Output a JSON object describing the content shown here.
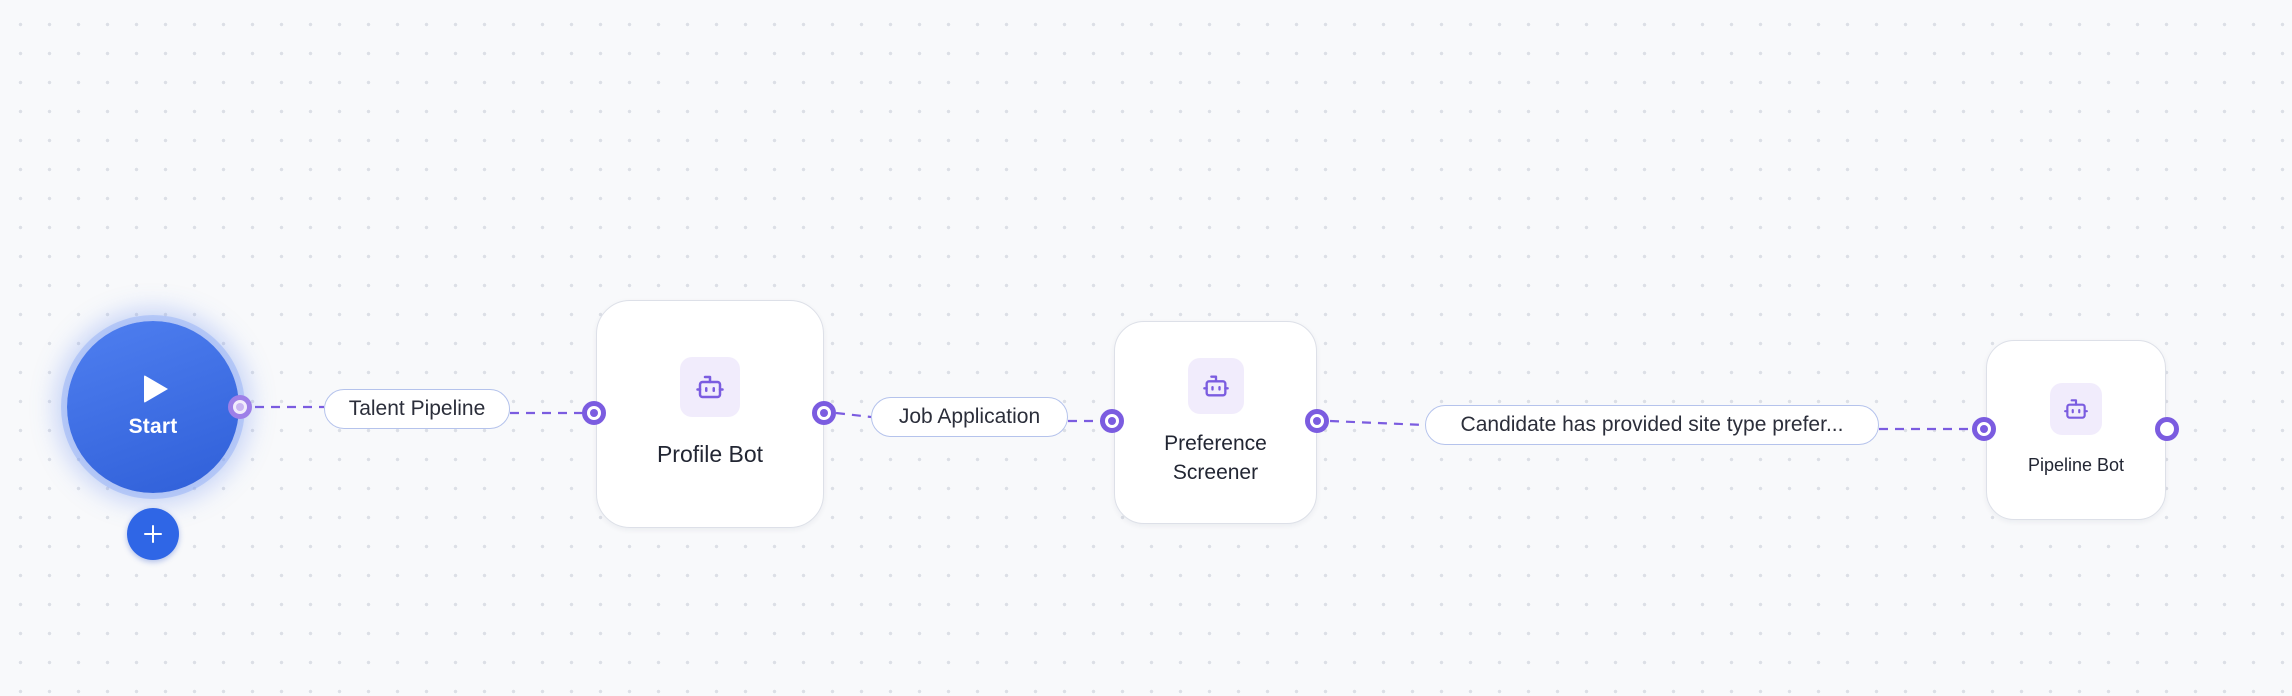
{
  "start_node": {
    "label": "Start",
    "icon": "play-icon"
  },
  "add_button": {
    "icon": "plus-icon"
  },
  "nodes": [
    {
      "id": "profile",
      "title": "Profile Bot",
      "icon": "bot-icon"
    },
    {
      "id": "pref",
      "title": "Preference Screener",
      "icon": "bot-icon"
    },
    {
      "id": "pipeline",
      "title": "Pipeline Bot",
      "icon": "bot-icon"
    }
  ],
  "edges": [
    {
      "from": "start",
      "to": "profile",
      "label": "Talent Pipeline"
    },
    {
      "from": "profile",
      "to": "pref",
      "label": "Job Application"
    },
    {
      "from": "pref",
      "to": "pipeline",
      "label": "Candidate has provided site type prefer..."
    }
  ],
  "colors": {
    "edge": "#7b5ce0",
    "start_node": "#3a6ee6",
    "handle": "#7b5ce0",
    "icon_tint": "#7b5ce0",
    "icon_bg": "#f1ecfc",
    "label_border": "#b5c3ec"
  }
}
